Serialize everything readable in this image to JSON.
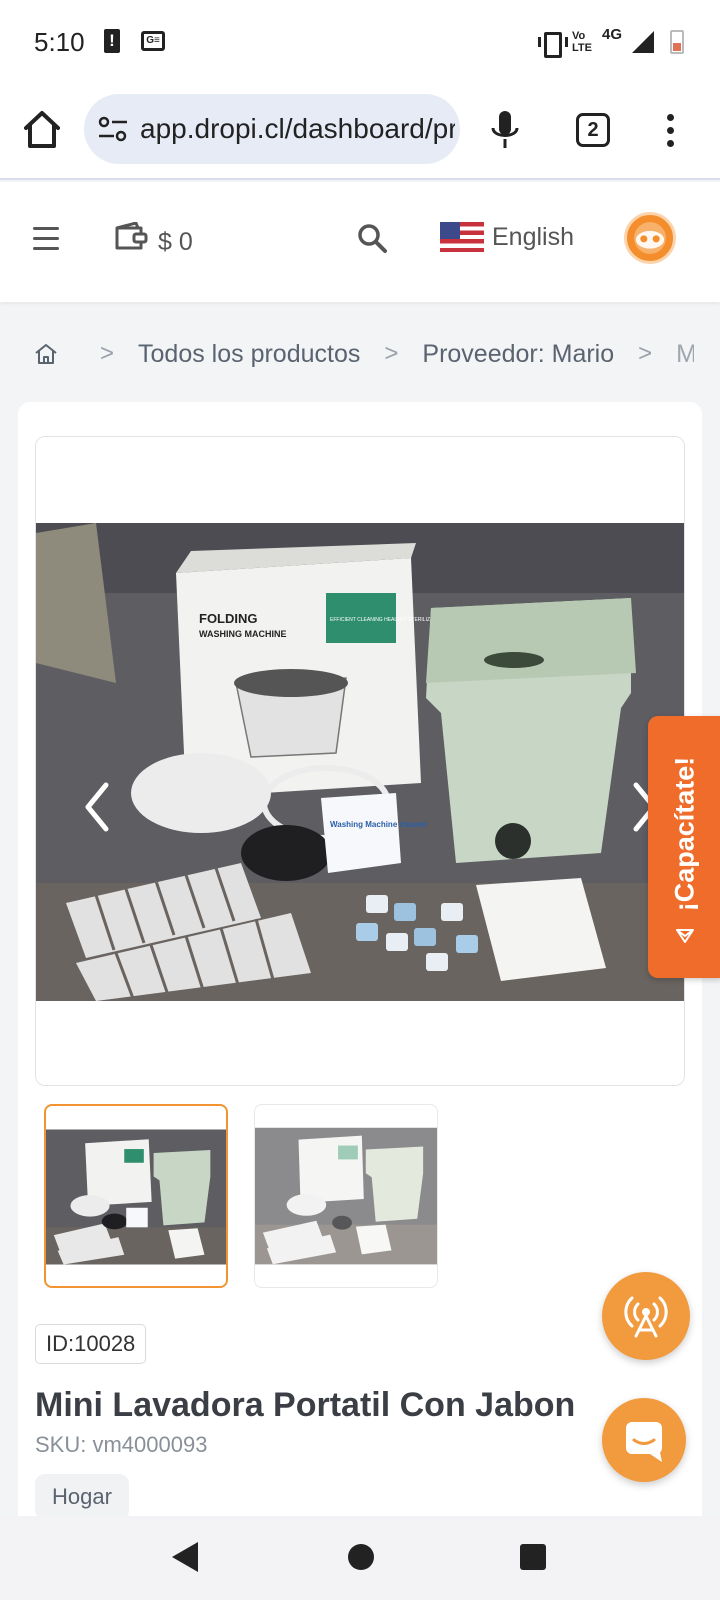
{
  "status_bar": {
    "time": "5:10",
    "volte_line1": "Vo",
    "volte_line2": "LTE",
    "network": "4G"
  },
  "browser": {
    "url": "app.dropi.cl/dashboard/product-details",
    "tab_count": "2"
  },
  "header": {
    "wallet_balance": "$ 0",
    "language": "English",
    "flag": "us-flag-icon"
  },
  "breadcrumb": {
    "items": [
      "Todos los productos",
      "Proveedor: Mario"
    ],
    "current": "Mini Lavadora Portatil Con Jabon"
  },
  "product": {
    "id_label": "ID:10028",
    "title": "Mini Lavadora Portatil Con Jabon",
    "sku": "SKU: vm4000093",
    "category": "Hogar",
    "box_text_1": "FOLDING",
    "box_text_2": "WASHING MACHINE",
    "box_badge": "EFFICIENT CLEANING HEALTHY STERILIZATION",
    "cleaner_text": "Washing Machine cleaner",
    "thumbnails": 2,
    "selected_thumbnail": 1
  },
  "side_tab": {
    "label": "¡Capacítate!"
  },
  "colors": {
    "accent": "#f19a3e",
    "side_tab": "#ef6c2a",
    "selected_border": "#f29434"
  }
}
